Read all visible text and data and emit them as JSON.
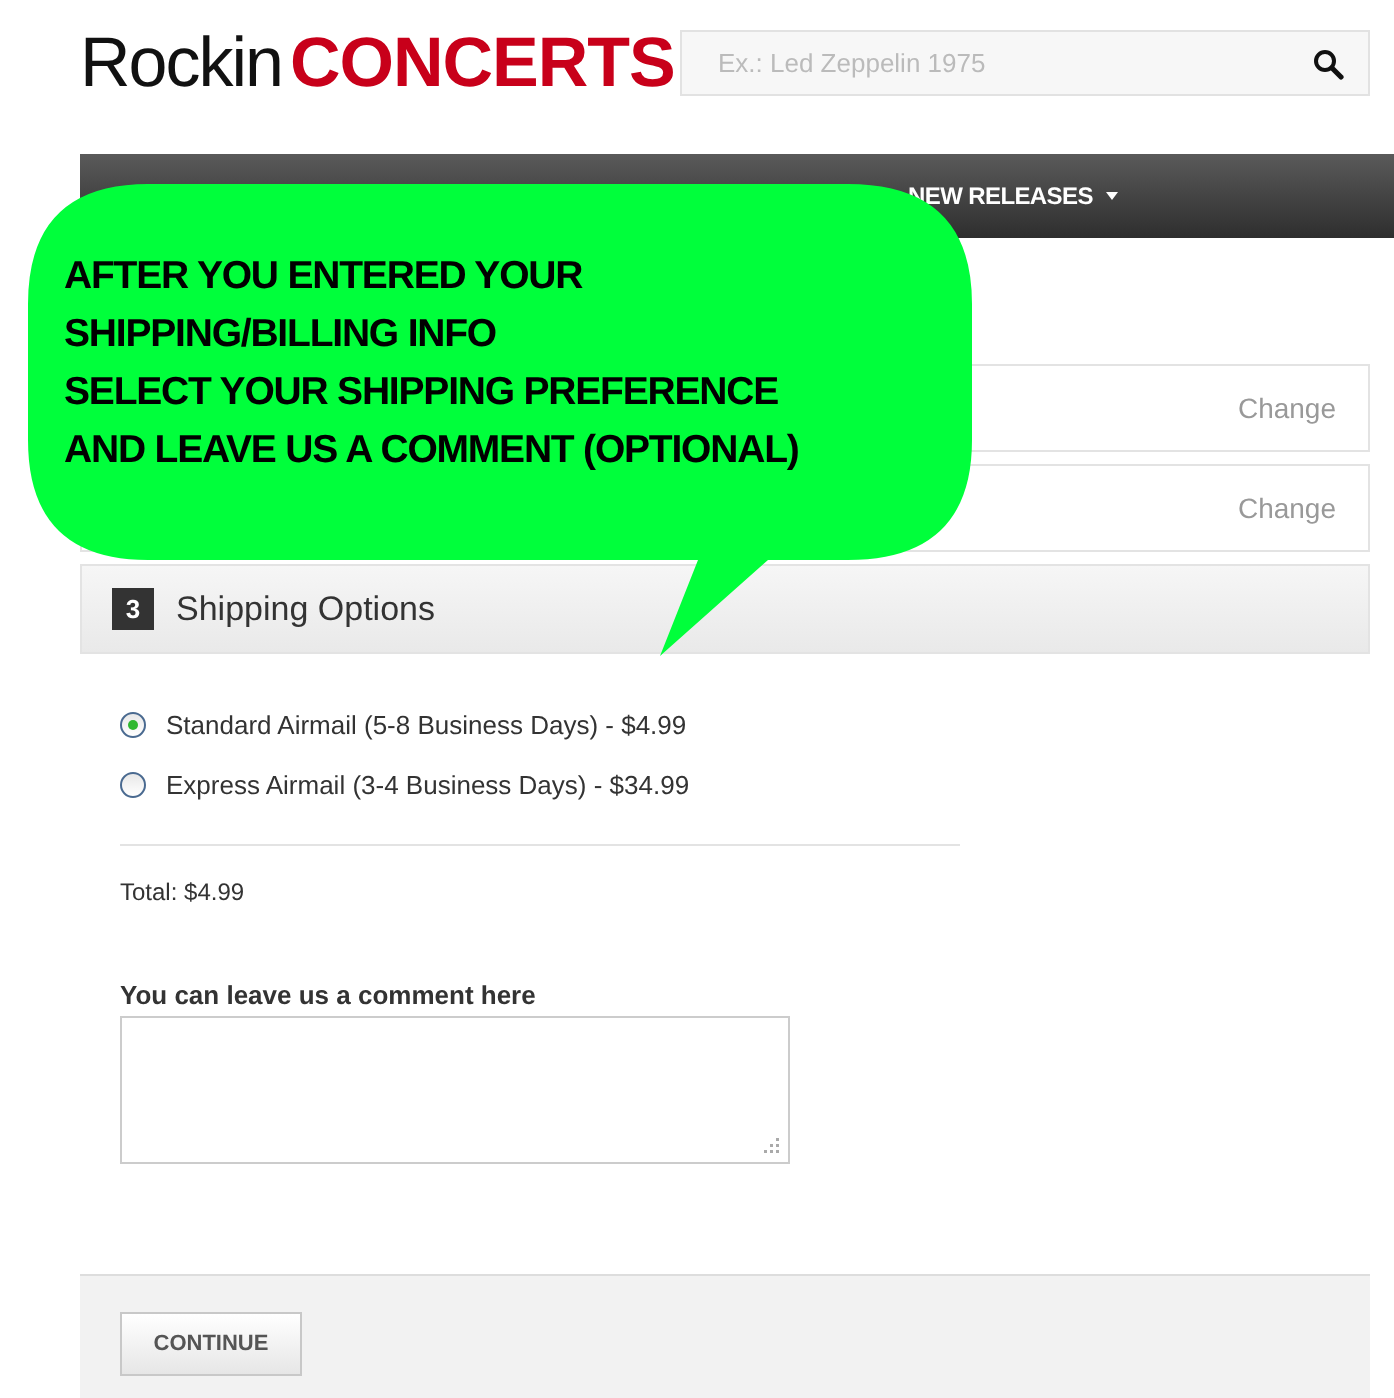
{
  "logo": {
    "part_1": "Rockin",
    "part_2": "CONCERTS"
  },
  "search": {
    "placeholder": "Ex.: Led Zeppelin 1975"
  },
  "nav": {
    "items": [
      {
        "label": "NEW RELEASES"
      }
    ]
  },
  "callout": {
    "text": "AFTER YOU ENTERED YOUR\nSHIPPING/BILLING INFO\nSELECT YOUR SHIPPING PREFERENCE\nAND LEAVE US A COMMENT (OPTIONAL)"
  },
  "steps": [
    {
      "kind": "collapsed",
      "link": "Change"
    },
    {
      "kind": "collapsed",
      "link": "Change"
    },
    {
      "kind": "active",
      "number": "3",
      "title": "Shipping Options"
    }
  ],
  "shipping_options": [
    {
      "label": "Standard Airmail (5-8 Business Days) - $4.99",
      "selected": true
    },
    {
      "label": "Express Airmail (3-4 Business Days) - $34.99",
      "selected": false
    }
  ],
  "total": "Total: $4.99",
  "comment": {
    "label": "You can leave us a comment here"
  },
  "continue_button": "CONTINUE"
}
